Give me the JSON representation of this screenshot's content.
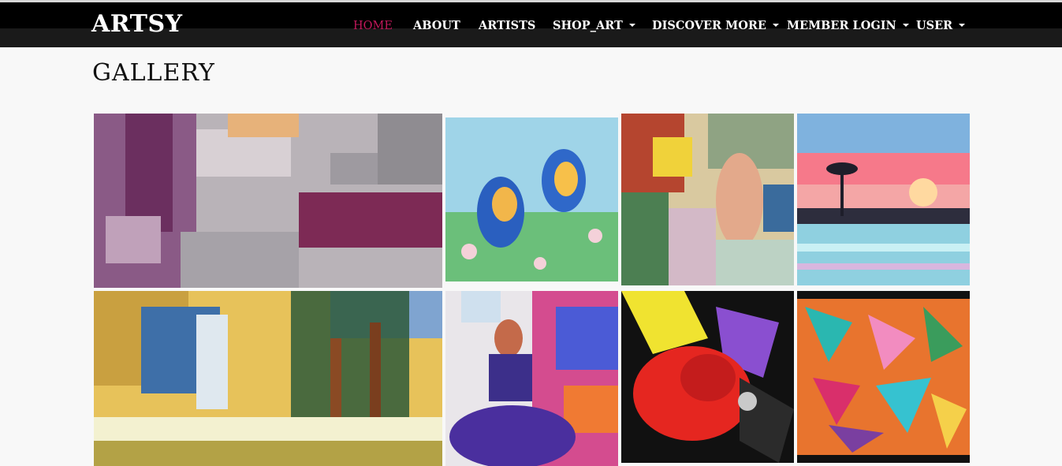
{
  "brand": "ARTSY",
  "nav": {
    "home": "HOME",
    "about": "ABOUT",
    "artists": "ARTISTS",
    "shop_art": "SHOP_ART",
    "discover_more": "DISCOVER MORE",
    "member_login": "MEMBER LOGIN",
    "user": "USER"
  },
  "page_title": "GALLERY",
  "colors": {
    "nav_active": "#c2185b",
    "navbar_bg": "#000000",
    "page_bg": "#f8f8f8"
  },
  "gallery": [
    {
      "subject": "abstract-purple-painting"
    },
    {
      "subject": "two-bluebirds-on-branch"
    },
    {
      "subject": "colorful-woman-among-flowers"
    },
    {
      "subject": "watercolor-tropical-sunset"
    },
    {
      "subject": "waterfall-and-pine-trees"
    },
    {
      "subject": "dancing-woman-mosaic"
    },
    {
      "subject": "red-flower-abstract-on-black"
    },
    {
      "subject": "multicolor-abstract-shards"
    }
  ]
}
